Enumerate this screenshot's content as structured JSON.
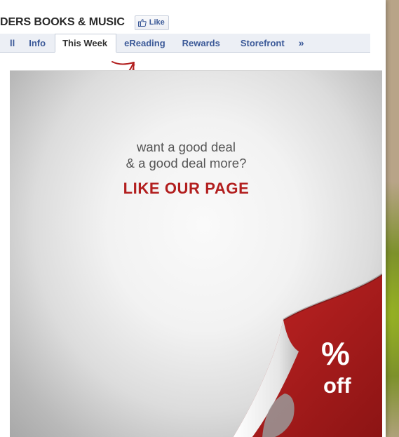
{
  "header": {
    "page_title": "DERS BOOKS & MUSIC",
    "like_label": "Like"
  },
  "tabs": [
    {
      "label": "ll",
      "active": false
    },
    {
      "label": "Info",
      "active": false
    },
    {
      "label": "This Week",
      "active": true
    },
    {
      "label": "eReading",
      "active": false
    },
    {
      "label": "Rewards",
      "active": false
    },
    {
      "label": "Storefront",
      "active": false
    }
  ],
  "tabs_more_label": "»",
  "promo": {
    "line1": "want a good deal",
    "line2": "& a good deal more?",
    "cta": "LIKE OUR PAGE",
    "discount_symbol": "%",
    "discount_off": "off"
  },
  "colors": {
    "accent_red": "#b21e1e",
    "link_blue": "#3b5998"
  },
  "icons": {
    "arrow": "hand-drawn-arrow-icon",
    "like_thumb": "thumbs-up-icon",
    "more_tabs": "double-chevron-right-icon"
  }
}
